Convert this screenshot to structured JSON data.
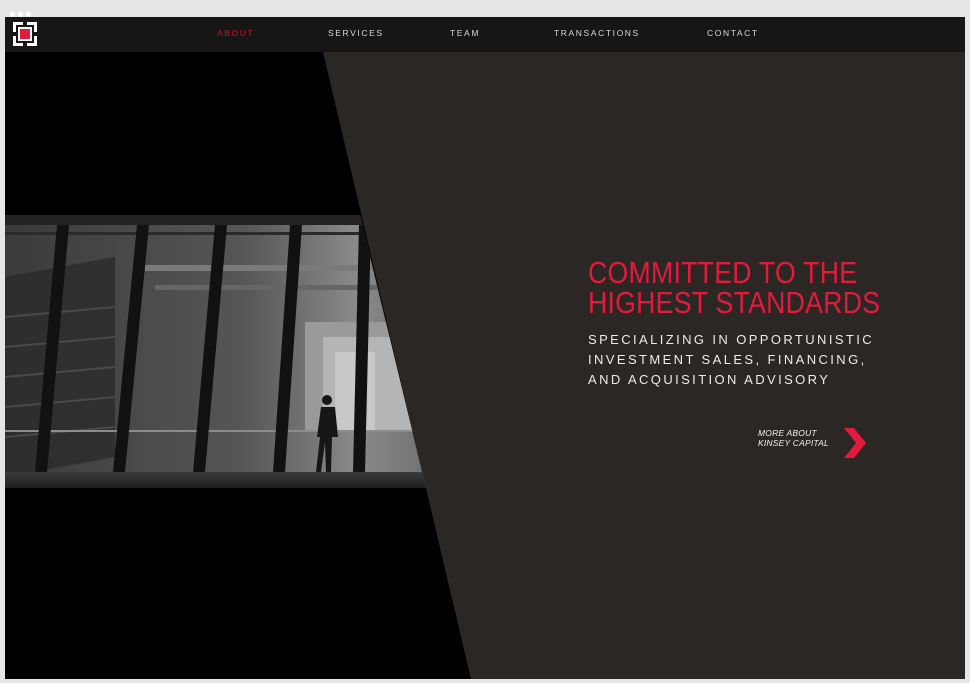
{
  "nav": {
    "items": [
      {
        "label": "ABOUT",
        "active": true
      },
      {
        "label": "SERVICES",
        "active": false
      },
      {
        "label": "TEAM",
        "active": false
      },
      {
        "label": "TRANSACTIONS",
        "active": false
      },
      {
        "label": "CONTACT",
        "active": false
      }
    ],
    "logo_icon": "kinsey-capital-logo-icon"
  },
  "hero": {
    "title_line1": "COMMITTED TO THE",
    "title_line2": "HIGHEST STANDARDS",
    "subtitle_line1": "SPECIALIZING IN OPPORTUNISTIC",
    "subtitle_line2": "INVESTMENT SALES, FINANCING,",
    "subtitle_line3": "AND ACQUISITION ADVISORY",
    "photo_icon": "building-interior-photo"
  },
  "cta": {
    "line1": "MORE ABOUT",
    "line2": "KINSEY CAPITAL",
    "icon": "chevron-right-icon"
  },
  "colors": {
    "accent": "#e21b3c",
    "nav_bg": "#171616",
    "panel_bg": "#2a2725",
    "black": "#000000"
  }
}
